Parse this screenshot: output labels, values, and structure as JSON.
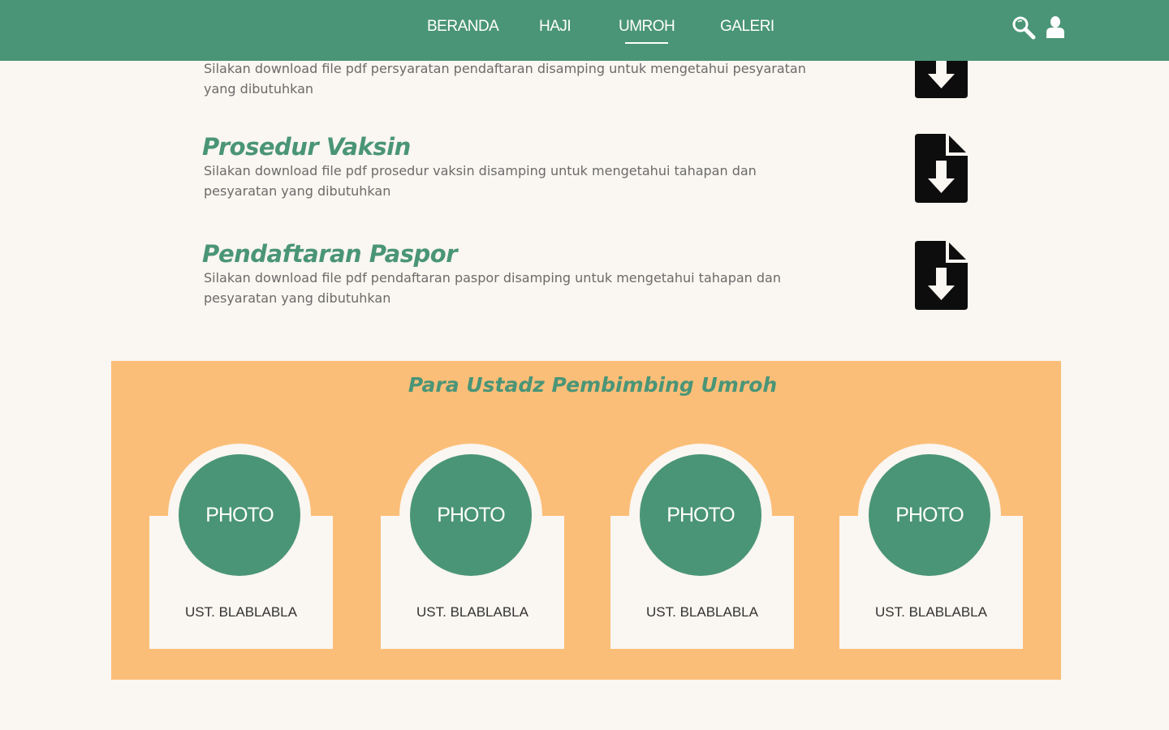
{
  "colors": {
    "brand_green": "#4a9577",
    "panel_orange": "#fbbe78",
    "page_background": "#faf6f1",
    "icon_black": "#0d0d0d"
  },
  "nav": {
    "items": [
      {
        "label": "BERANDA",
        "active": false
      },
      {
        "label": "HAJI",
        "active": false
      },
      {
        "label": "UMROH",
        "active": true
      },
      {
        "label": "GALERI",
        "active": false
      }
    ],
    "icons": [
      "search-icon",
      "user-icon"
    ]
  },
  "documents": [
    {
      "title": "",
      "description": "Silakan download file pdf persyaratan pendaftaran disamping untuk mengetahui pesyaratan yang dibutuhkan",
      "icon": "file-download-icon"
    },
    {
      "title": "Prosedur Vaksin",
      "description": "Silakan download file pdf prosedur vaksin disamping untuk mengetahui tahapan dan pesyaratan yang dibutuhkan",
      "icon": "file-download-icon"
    },
    {
      "title": "Pendaftaran Paspor",
      "description": "Silakan download file pdf pendaftaran paspor disamping untuk mengetahui tahapan dan pesyaratan yang dibutuhkan",
      "icon": "file-download-icon"
    }
  ],
  "ustadz_section": {
    "title": "Para Ustadz Pembimbing Umroh",
    "cards": [
      {
        "photo_label": "PHOTO",
        "name": "UST. BLABLABLA"
      },
      {
        "photo_label": "PHOTO",
        "name": "UST. BLABLABLA"
      },
      {
        "photo_label": "PHOTO",
        "name": "UST. BLABLABLA"
      },
      {
        "photo_label": "PHOTO",
        "name": "UST. BLABLABLA"
      }
    ]
  }
}
